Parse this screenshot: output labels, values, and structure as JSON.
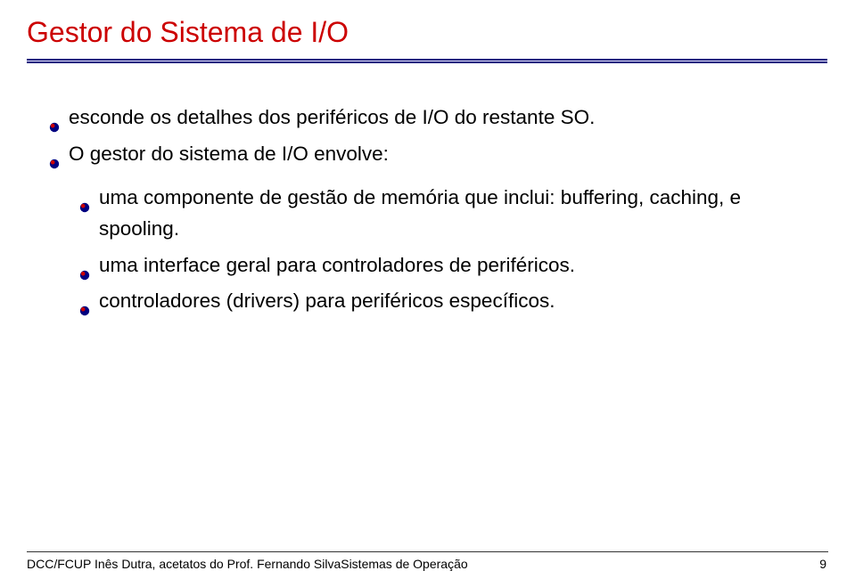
{
  "title": "Gestor do Sistema de I/O",
  "bullets": {
    "b1": "esconde os detalhes dos periféricos de I/O do restante SO.",
    "b2": "O gestor do sistema de I/O envolve:",
    "sub1": "uma componente de gestão de memória que inclui: buffering, caching, e spooling.",
    "sub2": "uma interface geral para controladores de periféricos.",
    "sub3": "controladores (drivers) para periféricos específicos."
  },
  "footer": {
    "left": "DCC/FCUP Inês Dutra, acetatos do Prof. Fernando SilvaSistemas de Operação",
    "page": "9"
  },
  "colors": {
    "title": "#cc0000",
    "rule": "#000080",
    "bullet_fill": "#000080",
    "bullet_highlight": "#cc0000"
  }
}
